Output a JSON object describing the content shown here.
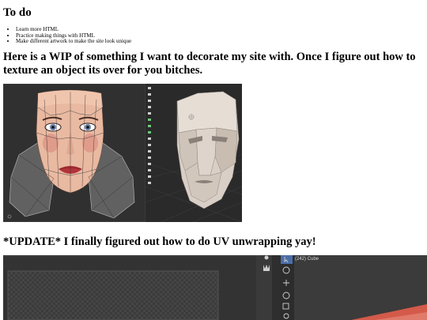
{
  "todo": {
    "heading": "To do",
    "items": [
      "Learn more HTML",
      "Practice making things with HTML",
      "Make different artwork to make the site look unique"
    ]
  },
  "wip": {
    "heading": "Here is a WIP of something I want to decorate my site with. Once I figure out how to texture an object its over for you bitches."
  },
  "update": {
    "heading": "*UPDATE* I finally figured out how to do UV unwrapping yay!"
  },
  "screenshot2": {
    "outliner_label": "(242) Cube"
  },
  "colors": {
    "background": "#ffffff",
    "text": "#000000",
    "viewport_dark": "#2f2f2f",
    "skin": "#e9b9a1",
    "mask_model": "#d9cfc6"
  }
}
